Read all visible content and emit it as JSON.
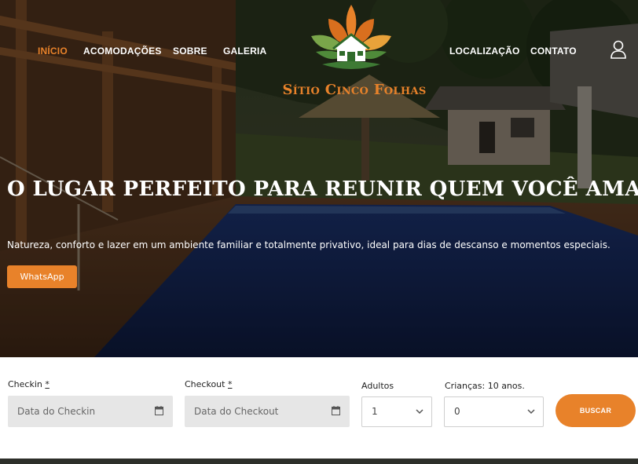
{
  "nav": {
    "items": [
      {
        "label": "INÍCIO",
        "active": true
      },
      {
        "label": "ACOMODAÇÕES",
        "active": false
      },
      {
        "label": "SOBRE",
        "active": false
      },
      {
        "label": "GALERIA",
        "active": false
      },
      {
        "label": "LOCALIZAÇÃO",
        "active": false
      },
      {
        "label": "CONTATO",
        "active": false
      }
    ],
    "user_icon": "user-icon"
  },
  "logo": {
    "text": "Sítio Cinco Folhas",
    "icon": "leaf-house-logo"
  },
  "hero": {
    "title": "O LUGAR PERFEITO PARA REUNIR QUEM VOCÊ AMA",
    "subtitle": "Natureza, conforto e lazer em um ambiente familiar e totalmente privativo, ideal para dias de descanso e momentos especiais.",
    "button_label": "WhatsApp"
  },
  "booking": {
    "checkin_label": "Checkin",
    "checkin_required": "*",
    "checkin_placeholder": "Data do Checkin",
    "checkout_label": "Checkout",
    "checkout_required": "*",
    "checkout_placeholder": "Data do Checkout",
    "adults_label": "Adultos",
    "adults_value": "1",
    "children_label": "Crianças: 10 anos.",
    "children_value": "0",
    "search_label": "BUSCAR"
  },
  "colors": {
    "accent": "#e8822a",
    "field_bg": "#e6e6e6",
    "leaf_green": "#4f8a3a",
    "leaf_orange": "#e8822a"
  }
}
